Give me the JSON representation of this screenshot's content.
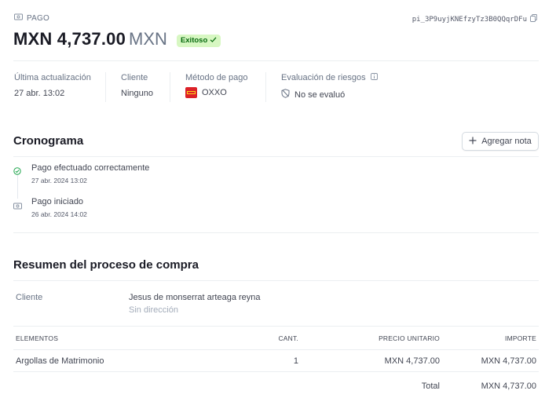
{
  "header": {
    "kind_label": "PAGO",
    "payment_id": "pi_3P9uyjKNEfzyTz3B0QQqrDFu",
    "amount": "MXN 4,737.00",
    "currency": "MXN",
    "status_badge": "Exitoso"
  },
  "meta": {
    "last_update": {
      "label": "Última actualización",
      "value": "27 abr. 13:02"
    },
    "customer": {
      "label": "Cliente",
      "value": "Ninguno"
    },
    "payment_method": {
      "label": "Método de pago",
      "value": "OXXO"
    },
    "risk": {
      "label": "Evaluación de riesgos",
      "value": "No se evaluó"
    }
  },
  "timeline": {
    "title": "Cronograma",
    "add_note_label": "Agregar nota",
    "events": [
      {
        "title": "Pago efectuado correctamente",
        "date": "27 abr. 2024 13:02"
      },
      {
        "title": "Pago iniciado",
        "date": "26 abr. 2024 14:02"
      }
    ]
  },
  "checkout": {
    "title": "Resumen del proceso de compra",
    "customer_label": "Cliente",
    "customer_name": "Jesus de monserrat arteaga reyna",
    "customer_address": "Sin dirección",
    "table": {
      "headers": [
        "ELEMENTOS",
        "CANT.",
        "PRECIO UNITARIO",
        "IMPORTE"
      ],
      "rows": [
        {
          "item": "Argollas de Matrimonio",
          "qty": "1",
          "unit_price": "MXN 4,737.00",
          "amount": "MXN 4,737.00"
        }
      ],
      "total_label": "Total",
      "total_value": "MXN 4,737.00"
    }
  },
  "colors": {
    "success_bg": "#d7f7c2",
    "success_fg": "#05690d",
    "oxxo_red": "#dc2128",
    "oxxo_yellow": "#fcd116"
  }
}
